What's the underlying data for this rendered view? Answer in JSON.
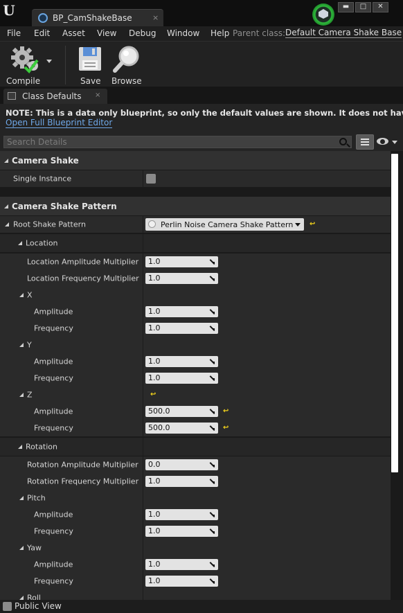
{
  "window": {
    "tab_label": "BP_CamShakeBase",
    "tab_close": "×",
    "minimize": "▬",
    "maximize": "□",
    "close": "✕"
  },
  "menu": {
    "items": [
      "File",
      "Edit",
      "Asset",
      "View",
      "Debug",
      "Window",
      "Help"
    ],
    "parent_class_label": "Parent class:",
    "parent_class_value": "Default Camera Shake Base"
  },
  "toolbar": {
    "compile": "Compile",
    "save": "Save",
    "browse": "Browse"
  },
  "panel": {
    "tab_label": "Class Defaults",
    "tab_close": "×",
    "note": "NOTE: This is a data only blueprint, so only the default values are shown.  It does not have any script or variables.",
    "open_editor_link": "Open Full Blueprint Editor",
    "search_placeholder": "Search Details"
  },
  "details": {
    "camera_shake": "Camera Shake",
    "single_instance": "Single Instance",
    "camera_shake_pattern": "Camera Shake Pattern",
    "root_shake_pattern": "Root Shake Pattern",
    "root_shake_pattern_value": "Perlin Noise Camera Shake Pattern",
    "location": "Location",
    "location_amplitude_multiplier": "Location Amplitude Multiplier",
    "location_amplitude_multiplier_value": "1.0",
    "location_frequency_multiplier": "Location Frequency Multiplier",
    "location_frequency_multiplier_value": "1.0",
    "x": "X",
    "x_amplitude": "Amplitude",
    "x_amplitude_value": "1.0",
    "x_frequency": "Frequency",
    "x_frequency_value": "1.0",
    "y": "Y",
    "y_amplitude": "Amplitude",
    "y_amplitude_value": "1.0",
    "y_frequency": "Frequency",
    "y_frequency_value": "1.0",
    "z": "Z",
    "z_amplitude": "Amplitude",
    "z_amplitude_value": "500.0",
    "z_frequency": "Frequency",
    "z_frequency_value": "500.0",
    "rotation": "Rotation",
    "rotation_amplitude_multiplier": "Rotation Amplitude Multiplier",
    "rotation_amplitude_multiplier_value": "0.0",
    "rotation_frequency_multiplier": "Rotation Frequency Multiplier",
    "rotation_frequency_multiplier_value": "1.0",
    "pitch": "Pitch",
    "pitch_amplitude": "Amplitude",
    "pitch_amplitude_value": "1.0",
    "pitch_frequency": "Frequency",
    "pitch_frequency_value": "1.0",
    "yaw": "Yaw",
    "yaw_amplitude": "Amplitude",
    "yaw_amplitude_value": "1.0",
    "yaw_frequency": "Frequency",
    "yaw_frequency_value": "1.0",
    "roll": "Roll",
    "reset_glyph": "↩"
  },
  "footer": {
    "public_view": "Public View"
  },
  "colors": {
    "link": "#6fa8e8",
    "reset_arrow": "#f2d21b",
    "badge_green": "#2fbb3c"
  }
}
